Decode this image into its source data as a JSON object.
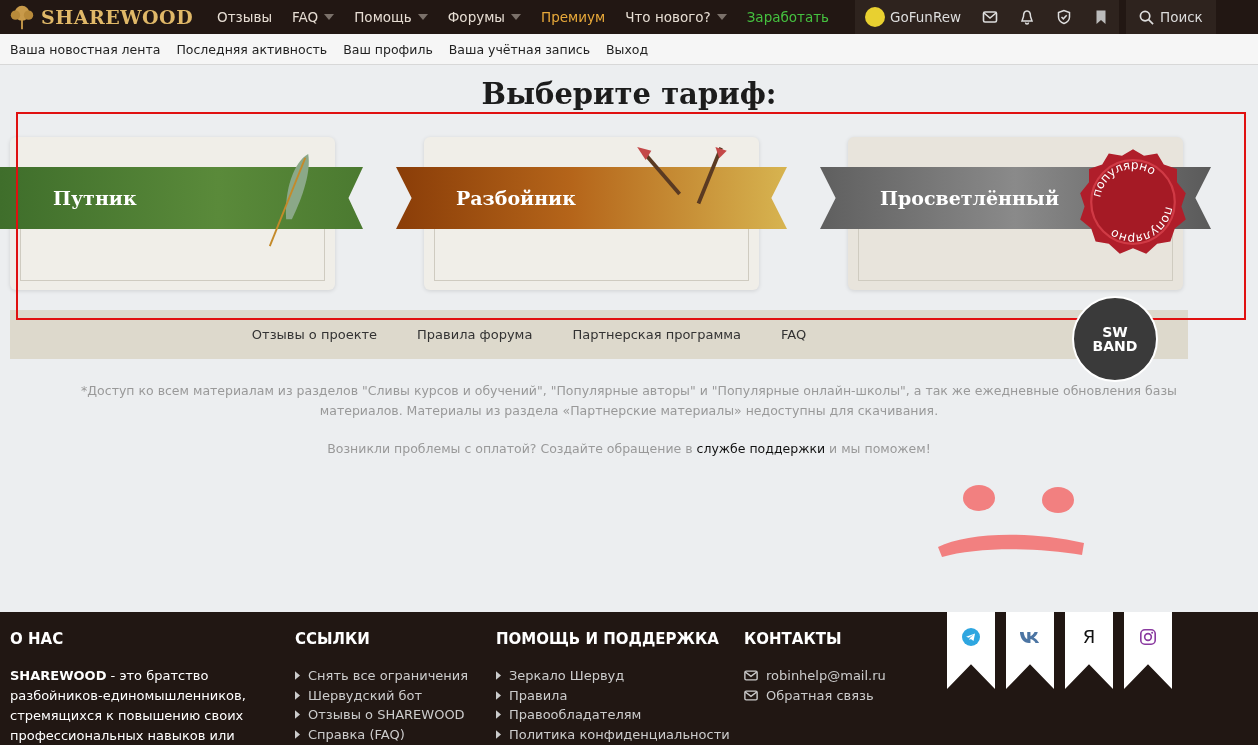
{
  "header": {
    "logo": "SHAREWOOD",
    "nav": [
      {
        "label": "Отзывы",
        "dropdown": false,
        "color": "#e6ddd3"
      },
      {
        "label": "FAQ",
        "dropdown": true,
        "color": "#e6ddd3"
      },
      {
        "label": "Помощь",
        "dropdown": true,
        "color": "#e6ddd3"
      },
      {
        "label": "Форумы",
        "dropdown": true,
        "color": "#e6ddd3"
      },
      {
        "label": "Премиум",
        "dropdown": false,
        "color": "#e8a93a"
      },
      {
        "label": "Что нового?",
        "dropdown": true,
        "color": "#e6ddd3"
      },
      {
        "label": "Заработать",
        "dropdown": false,
        "color": "#45c13f"
      }
    ],
    "username": "GoFunRew",
    "search": "Поиск"
  },
  "subnav": [
    "Ваша новостная лента",
    "Последняя активность",
    "Ваш профиль",
    "Ваша учётная запись",
    "Выход"
  ],
  "title": "Выберите тариф:",
  "plans": [
    {
      "name": "Путник",
      "kind": "quill"
    },
    {
      "name": "Разбойник",
      "kind": "arrows"
    },
    {
      "name": "Просветлённый",
      "kind": "seal",
      "seal_texts": [
        "популярно",
        "популярно"
      ]
    }
  ],
  "strip_links": [
    "Отзывы о проекте",
    "Правила форума",
    "Партнерская программа",
    "FAQ"
  ],
  "strip_logo": [
    "SW",
    "BAND"
  ],
  "note": "*Доступ ко всем материалам из разделов \"Сливы курсов и обучений\", \"Популярные авторы\" и \"Популярные онлайн-школы\", а так же ежедневные обновления базы материалов. Материалы из раздела «Партнерские материалы» недоступны для скачивания.",
  "support": {
    "before": "Возникли проблемы с оплатой? Создайте обращение в",
    "link": "службе поддержки",
    "after": "и мы поможем!"
  },
  "footer": {
    "about": {
      "heading": "О НАС",
      "text": "**SHAREWOOD** - это братство разбойников-единомышленников, стремящихся к повышению своих профессиональных навыков или"
    },
    "links": {
      "heading": "ССЫЛКИ",
      "items": [
        "Снять все ограничения",
        "Шервудский бот",
        "Отзывы о SHAREWOOD",
        "Справка (FAQ)"
      ]
    },
    "help": {
      "heading": "ПОМОЩЬ И ПОДДЕРЖКА",
      "items": [
        "Зеркало Шервуд",
        "Правила",
        "Правообладателям",
        "Политика конфиденциальности"
      ]
    },
    "contacts": {
      "heading": "КОНТАКТЫ",
      "items": [
        "robinhelp@mail.ru",
        "Обратная связь"
      ]
    },
    "social": [
      {
        "kind": "telegram"
      },
      {
        "kind": "vk"
      },
      {
        "kind": "text",
        "label": "Я"
      },
      {
        "kind": "instagram"
      }
    ]
  }
}
